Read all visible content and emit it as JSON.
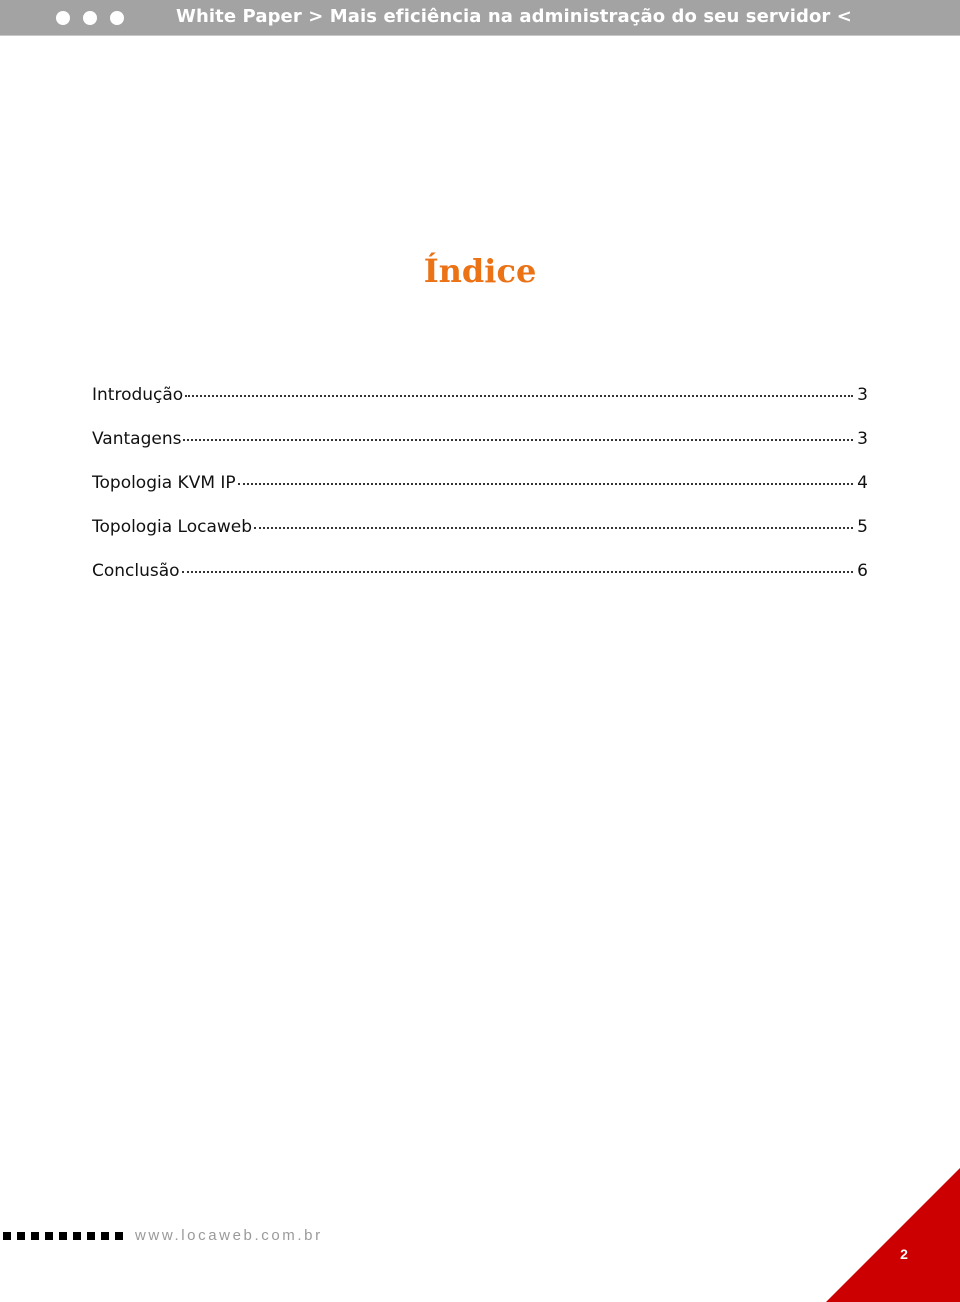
{
  "header": {
    "dots_count": 3,
    "title": "White Paper > Mais eficiência na administração do seu servidor <",
    "background_color": "#a3a3a3"
  },
  "page": {
    "title": "Índice",
    "title_color": "#ec7216"
  },
  "toc": {
    "entries": [
      {
        "label": "Introdução",
        "page": "3"
      },
      {
        "label": "Vantagens",
        "page": "3"
      },
      {
        "label": "Topologia KVM IP",
        "page": "4"
      },
      {
        "label": "Topologia Locaweb",
        "page": "5"
      },
      {
        "label": "Conclusão",
        "page": "6"
      }
    ]
  },
  "footer": {
    "squares_count": 9,
    "url": "www.locaweb.com.br",
    "page_number": "2",
    "accent_color": "#cc0000"
  }
}
